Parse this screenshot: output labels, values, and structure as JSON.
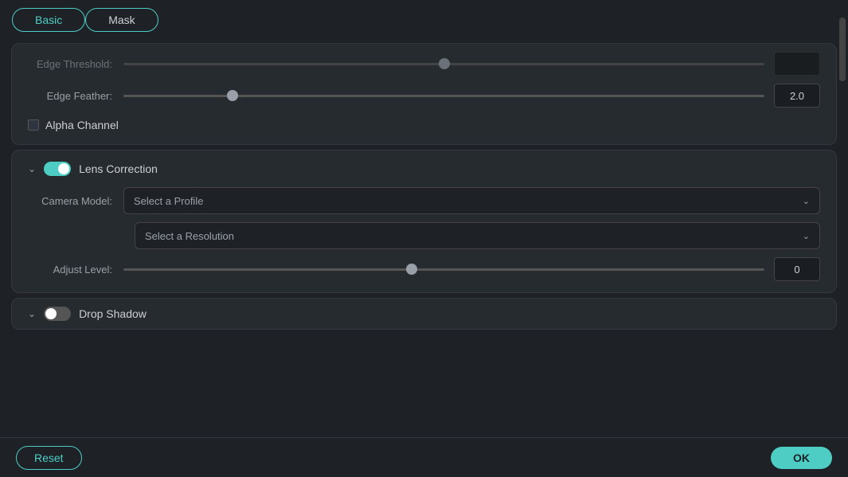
{
  "tabs": [
    {
      "id": "basic",
      "label": "Basic",
      "active": true
    },
    {
      "id": "mask",
      "label": "Mask",
      "active": false
    }
  ],
  "topCard": {
    "edgeThreshold": {
      "label": "Edge Threshold:",
      "sliderPercent": 50,
      "value": ""
    },
    "edgeFeather": {
      "label": "Edge Feather:",
      "sliderPercent": 17,
      "value": "2.0"
    },
    "alphaChannel": {
      "label": "Alpha Channel",
      "checked": false
    }
  },
  "lensCorrection": {
    "title": "Lens Correction",
    "enabled": true,
    "cameraModel": {
      "label": "Camera Model:",
      "placeholder": "Select a Profile"
    },
    "resolution": {
      "placeholder": "Select a Resolution"
    },
    "adjustLevel": {
      "label": "Adjust Level:",
      "sliderPercent": 45,
      "value": "0"
    }
  },
  "dropShadow": {
    "title": "Drop Shadow",
    "enabled": false
  },
  "buttons": {
    "reset": "Reset",
    "ok": "OK"
  }
}
